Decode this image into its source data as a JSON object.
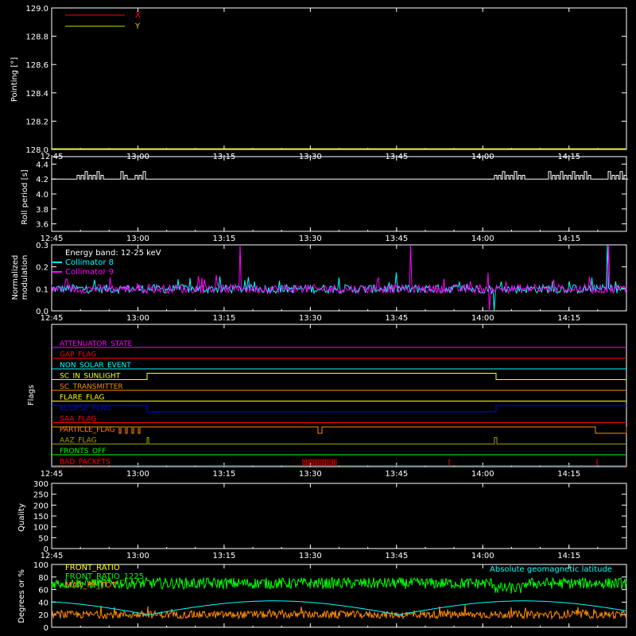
{
  "colors": {
    "background": "#000000",
    "axis": "#ffffff",
    "x_series": "#ff0000",
    "y_series": "#d7d700",
    "collimator8": "#00ffff",
    "collimator9": "#ff00ff",
    "front_ratio": "#ffff00",
    "front_ratio_1225": "#00ff00",
    "max_pp_tot": "#ff8c00",
    "geomag": "#00ffff"
  },
  "time_axis": {
    "start": "12:45",
    "end": "14:25",
    "ticks": [
      "12:45",
      "13:00",
      "13:15",
      "13:30",
      "13:45",
      "14:00",
      "14:15"
    ]
  },
  "chart_data": [
    {
      "type": "line",
      "panel": "pointing",
      "ylabel": "Pointing [°]",
      "ylim": [
        128.0,
        129.0
      ],
      "yticks": [
        "128.0",
        "128.2",
        "128.4",
        "128.6",
        "128.8",
        "129.0"
      ],
      "legend": [
        "X",
        "Y"
      ],
      "series": [
        {
          "name": "X",
          "values": []
        },
        {
          "name": "Y",
          "values": []
        }
      ]
    },
    {
      "type": "line",
      "panel": "roll",
      "ylabel": "Roll period [s]",
      "ylim": [
        3.5,
        4.5
      ],
      "yticks": [
        "3.6",
        "3.8",
        "4.0",
        "4.2",
        "4.4"
      ],
      "base_value": 4.2,
      "bump_value": 4.25
    },
    {
      "type": "line",
      "panel": "modulation",
      "ylabel": "Normalized\nmodulation",
      "ylim": [
        0.0,
        0.3
      ],
      "yticks": [
        "0.0",
        "0.1",
        "0.2",
        "0.3"
      ],
      "annotation": "Energy band: 12-25 keV",
      "series": [
        {
          "name": "Collimator 8"
        },
        {
          "name": "Collimator 9"
        }
      ],
      "baseline": 0.1
    },
    {
      "type": "line",
      "panel": "flags",
      "ylabel": "Flags",
      "flags": [
        {
          "name": "ATTENUATOR_STATE",
          "color": "#ff00ff"
        },
        {
          "name": "GAP_FLAG",
          "color": "#ff0000"
        },
        {
          "name": "NON_SOLAR_EVENT",
          "color": "#00ffff"
        },
        {
          "name": "SC_IN_SUNLIGHT",
          "color": "#ffff00"
        },
        {
          "name": "SC_TRANSMITTER",
          "color": "#ff8c00"
        },
        {
          "name": "FLARE_FLAG",
          "color": "#ffff00"
        },
        {
          "name": "ECLIPSE_FLAG",
          "color": "#0000ff"
        },
        {
          "name": "SAA_FLAG",
          "color": "#ff0000"
        },
        {
          "name": "PARTICLE_FLAG",
          "color": "#ff8c00"
        },
        {
          "name": "AAZ_FLAG",
          "color": "#a0a000"
        },
        {
          "name": "FRONTS_OFF",
          "color": "#00ff00"
        },
        {
          "name": "BAD_PACKETS",
          "color": "#ff0000"
        }
      ]
    },
    {
      "type": "line",
      "panel": "quality",
      "ylabel": "Quality",
      "ylim": [
        0,
        300
      ],
      "yticks": [
        "0",
        "50",
        "100",
        "150",
        "200",
        "250",
        "300"
      ]
    },
    {
      "type": "line",
      "panel": "ratios",
      "ylabel": "Degrees or %",
      "ylim": [
        0,
        100
      ],
      "yticks": [
        "0",
        "20",
        "40",
        "60",
        "80",
        "100"
      ],
      "series": [
        {
          "name": "FRONT_RATIO",
          "level": 0
        },
        {
          "name": "FRONT_RATIO_1225",
          "level": 70
        },
        {
          "name": "MAX_PP_TOT",
          "level": 20
        }
      ],
      "annotation": "Absolute geomagnetic latitude"
    }
  ]
}
